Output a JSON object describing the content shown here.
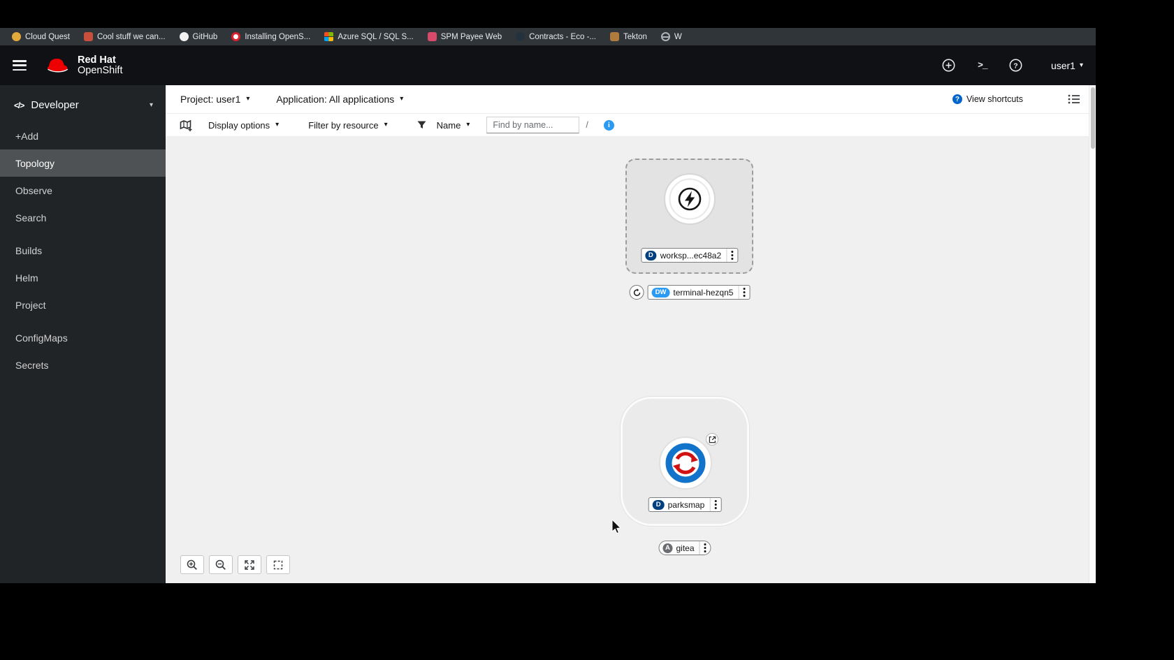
{
  "colors": {
    "badge_deployment": "#004080",
    "badge_devworkspace": "#2b9af3",
    "badge_application": "#6a6e73",
    "accent_blue": "#2b9af3",
    "link_blue": "#0066cc"
  },
  "bookmarks_bar": {
    "items": [
      {
        "label": "Cloud Quest"
      },
      {
        "label": "Cool stuff we can..."
      },
      {
        "label": "GitHub"
      },
      {
        "label": "Installing OpenS..."
      },
      {
        "label": "Azure SQL / SQL S..."
      },
      {
        "label": "SPM Payee Web"
      },
      {
        "label": "Contracts - Eco -..."
      },
      {
        "label": "Tekton"
      },
      {
        "label": "W"
      }
    ]
  },
  "masthead": {
    "brand_top": "Red Hat",
    "brand_bottom": "OpenShift",
    "terminal_icon": ">_",
    "help_icon": "?",
    "user_menu": "user1"
  },
  "sidebar": {
    "perspective": "Developer",
    "items": [
      {
        "label": "+Add"
      },
      {
        "label": "Topology"
      },
      {
        "label": "Observe"
      },
      {
        "label": "Search"
      },
      {
        "label": "Builds"
      },
      {
        "label": "Helm"
      },
      {
        "label": "Project"
      },
      {
        "label": "ConfigMaps"
      },
      {
        "label": "Secrets"
      }
    ]
  },
  "context_bar": {
    "project": "Project: user1",
    "application": "Application: All applications",
    "view_shortcuts": "View shortcuts",
    "help_badge": "?"
  },
  "toolbar": {
    "display_options": "Display options",
    "filter_by_resource": "Filter by resource",
    "name_filter": "Name",
    "find_placeholder": "Find by name...",
    "shortcut_hint": "/",
    "info_glyph": "i"
  },
  "topology": {
    "devworkspace": {
      "badge": "D",
      "label": "worksp...ec48a2"
    },
    "terminal": {
      "badge": "DW",
      "label": "terminal-hezqn5"
    },
    "parksmap": {
      "badge": "D",
      "label": "parksmap"
    },
    "gitea": {
      "badge": "A",
      "label": "gitea"
    }
  },
  "icons": {
    "caret": "▾",
    "code": "</>"
  }
}
